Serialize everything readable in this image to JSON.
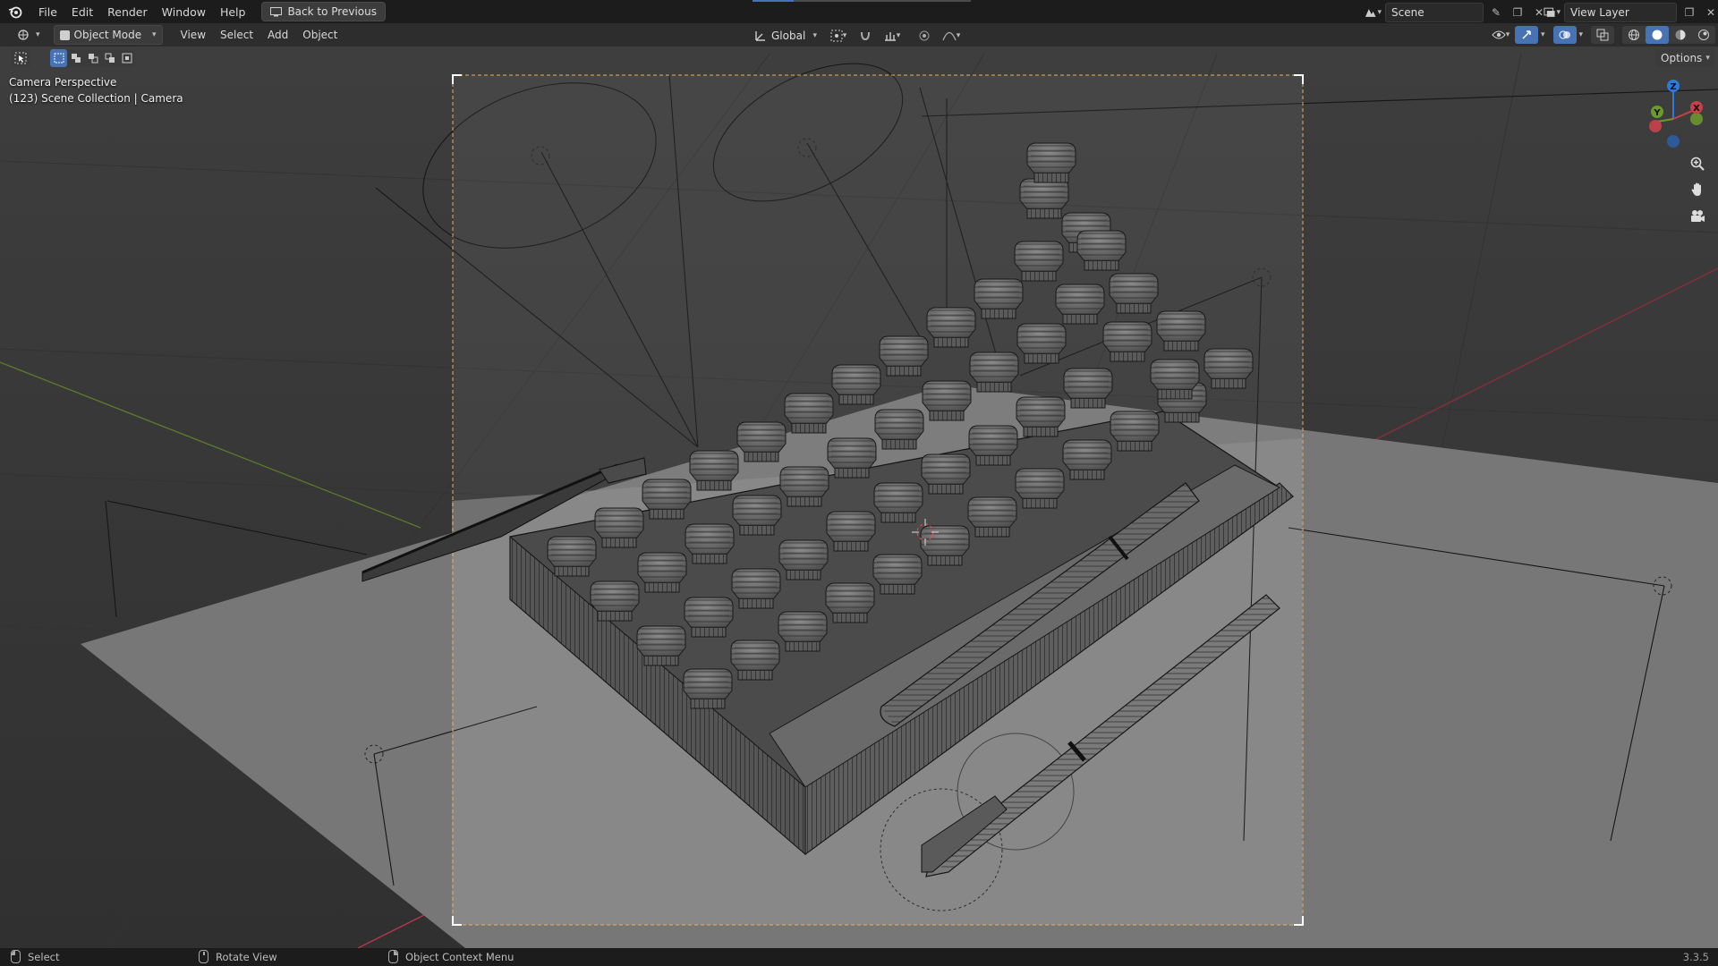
{
  "app_menu": {
    "items": [
      "File",
      "Edit",
      "Render",
      "Window",
      "Help"
    ],
    "back_button": "Back to Previous"
  },
  "scene": {
    "name": "Scene"
  },
  "view_layer": {
    "name": "View Layer"
  },
  "header": {
    "mode": "Object Mode",
    "menus": [
      "View",
      "Select",
      "Add",
      "Object"
    ],
    "orientation": "Global",
    "options_label": "Options"
  },
  "viewport": {
    "perspective_label": "Camera Perspective",
    "collection_label": "(123) Scene Collection | Camera",
    "gizmo_labels": {
      "z": "Z",
      "y": "Y",
      "x": "X"
    }
  },
  "status": {
    "left_click": "Select",
    "middle_click": "Rotate View",
    "right_click": "Object Context Menu",
    "version": "3.3.5"
  },
  "colors": {
    "accent": "#4772b3",
    "x_axis": "#c8404a",
    "y_axis": "#6d9b2a",
    "z_axis": "#2a7ae0",
    "camera_frame": "#e8b15a"
  },
  "icons": {
    "app": "blender-logo-icon",
    "back": "screen-icon",
    "zoom": "zoom-icon",
    "pan": "hand-icon",
    "camera": "camera-icon"
  }
}
